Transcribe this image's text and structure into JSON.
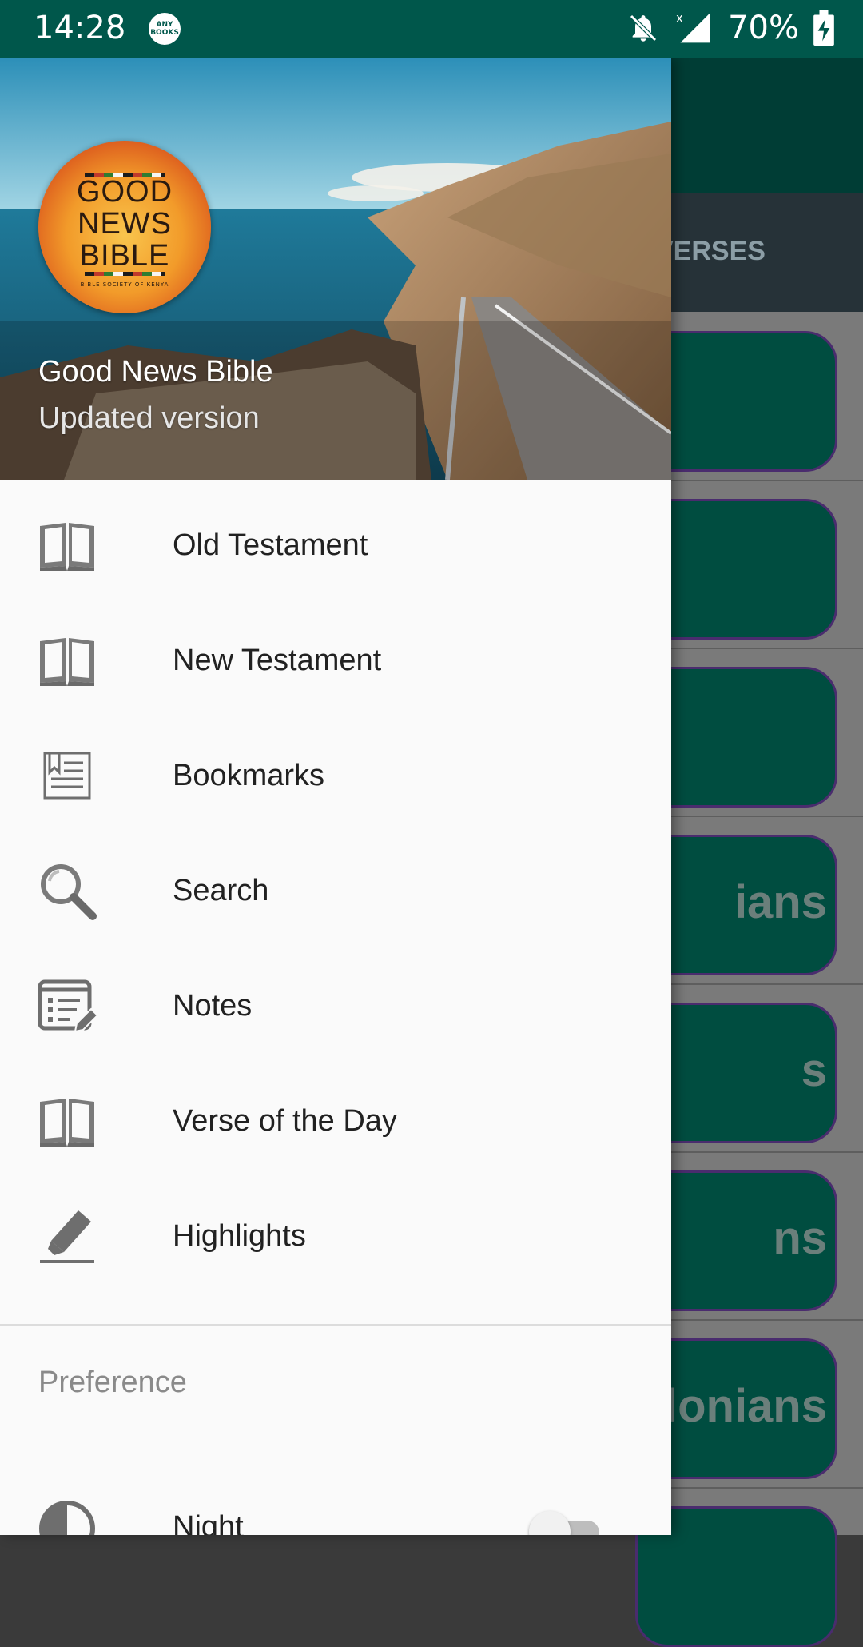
{
  "status_bar": {
    "time": "14:28",
    "notification_badge": "ANY BOOKS",
    "battery": "70%",
    "icons": [
      "anybooks-icon",
      "mute-notifications-icon",
      "signal-icon",
      "battery-charging-icon"
    ]
  },
  "background_app": {
    "tab_label": "VERSES",
    "cards": [
      "",
      "",
      "",
      "ians",
      "s",
      "ns",
      "lonians",
      ""
    ]
  },
  "drawer": {
    "header": {
      "logo_text": [
        "GOOD",
        "NEWS",
        "BIBLE"
      ],
      "logo_caption": "BIBLE SOCIETY OF KENYA",
      "title": "Good News Bible",
      "subtitle": "Updated version"
    },
    "items": [
      {
        "label": "Old Testament",
        "icon": "open-book-icon"
      },
      {
        "label": "New Testament",
        "icon": "open-book-icon"
      },
      {
        "label": "Bookmarks",
        "icon": "bookmark-page-icon"
      },
      {
        "label": "Search",
        "icon": "search-icon"
      },
      {
        "label": "Notes",
        "icon": "notes-icon"
      },
      {
        "label": "Verse of the Day",
        "icon": "open-book-icon"
      },
      {
        "label": "Highlights",
        "icon": "highlighter-icon"
      }
    ],
    "section_label": "Preference",
    "night": {
      "label": "Night",
      "icon": "contrast-icon",
      "enabled": false
    }
  },
  "colors": {
    "status_bar": "#00574b",
    "accent_dark": "#004d40",
    "drawer_bg": "#fafafa",
    "icon_gray": "#6e6e6e"
  }
}
